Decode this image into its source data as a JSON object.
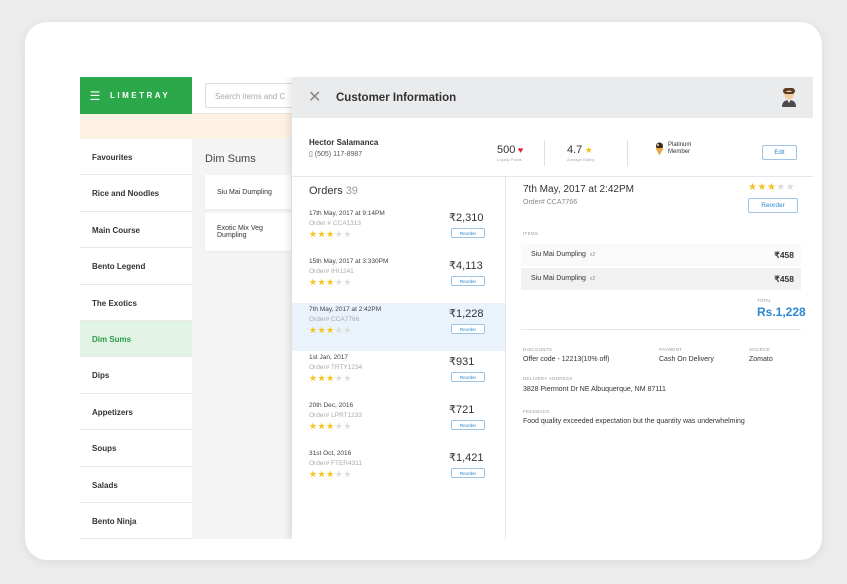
{
  "app": {
    "brand": "LIMETRAY",
    "search_placeholder": "Search items and C",
    "category_title": "Dim Sums",
    "sidebar": [
      {
        "label": "Favourites"
      },
      {
        "label": "Rice and Noodles"
      },
      {
        "label": "Main Course"
      },
      {
        "label": "Bento Legend"
      },
      {
        "label": "The Exotics"
      },
      {
        "label": "Dim Sums",
        "active": true
      },
      {
        "label": "Dips"
      },
      {
        "label": "Appetizers"
      },
      {
        "label": "Soups"
      },
      {
        "label": "Salads"
      },
      {
        "label": "Bento Ninja"
      }
    ],
    "dishes": [
      {
        "label": "Siu Mai Dumpling"
      },
      {
        "label": "Exotic Mix Veg Dumpling"
      }
    ]
  },
  "panel": {
    "title": "Customer Information",
    "customer": {
      "name": "Hector Salamanca",
      "phone": "(505) 117-8987",
      "loyalty_points": "500",
      "loyalty_label": "Loyalty Points",
      "rating": "4.7",
      "rating_label": "Average Rating",
      "tier": "Platinum\nMember",
      "edit_label": "Edit"
    },
    "orders_title": "Orders",
    "orders_count": "39",
    "orders": [
      {
        "date": "17th May, 2017 at 9:14PM",
        "id": "Order # CCA1313",
        "amount": "₹2,310",
        "stars": 3,
        "reorder": "Reorder"
      },
      {
        "date": "15th May, 2017 at 3:330PM",
        "id": "Order# IHI1241",
        "amount": "₹4,113",
        "stars": 3,
        "reorder": "Reorder"
      },
      {
        "date": "7th May, 2017 at 2:42PM",
        "id": "Order# CCA7766",
        "amount": "₹1,228",
        "stars": 3,
        "reorder": "Reorder",
        "active": true
      },
      {
        "date": "1st Jan, 2017",
        "id": "Order# TRTY1234",
        "amount": "₹931",
        "stars": 3,
        "reorder": "Reorder"
      },
      {
        "date": "20th Dec, 2016",
        "id": "Order# LPRT1233",
        "amount": "₹721",
        "stars": 3,
        "reorder": "Reorder"
      },
      {
        "date": "31st Oct, 2016",
        "id": "Order# FTER4311",
        "amount": "₹1,421",
        "stars": 3,
        "reorder": "Reorder"
      }
    ],
    "detail": {
      "date": "7th May, 2017 at 2:42PM",
      "id": "Order# CCA7766",
      "stars": 3,
      "reorder": "Reorder",
      "items_label": "ITEMS",
      "items": [
        {
          "name": "Siu Mai Dumpling",
          "qty": "x2",
          "price": "₹458"
        },
        {
          "name": "Siu Mai Dumpling",
          "qty": "x2",
          "price": "₹458"
        }
      ],
      "total_label": "TOTAL",
      "total": "Rs.1,228",
      "discounts_label": "DISCOUNTS",
      "discounts": "Offer code - 12213(10% off)",
      "payment_label": "PAYMENT",
      "payment": "Cash On Delivery",
      "source_label": "SOURCE",
      "source": "Zomato",
      "address_label": "DELIVERY ADDRESS",
      "address": "3828 Piermont Dr NE Albuquerque, NM 87111",
      "feedback_label": "FEEDBACK",
      "feedback": "Food quality exceeded expectation but the quantity was underwhelming"
    }
  },
  "colors": {
    "brand_green": "#2aa84a",
    "accent_blue": "#2b87d1",
    "star": "#f6c21b",
    "heart": "#e0262f"
  }
}
